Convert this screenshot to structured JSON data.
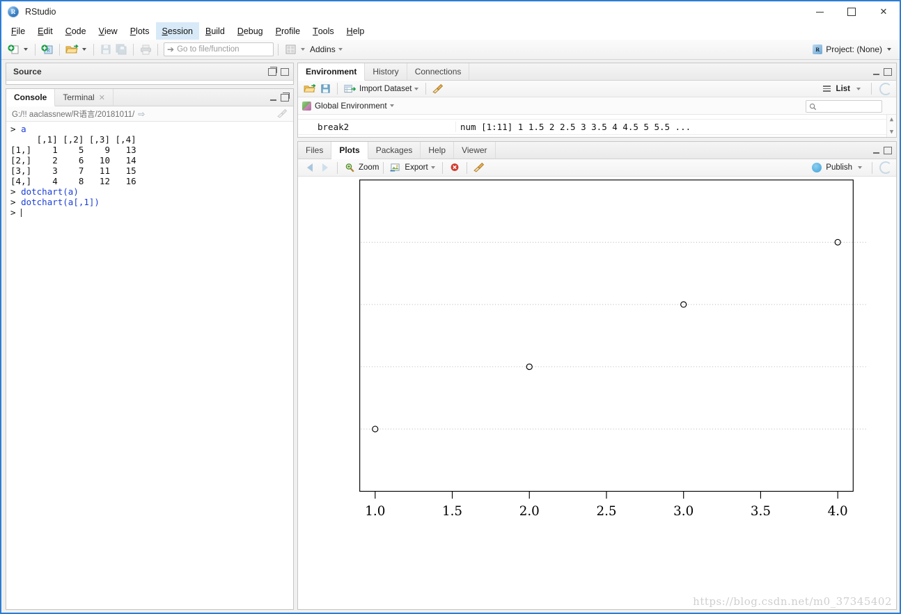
{
  "window": {
    "title": "RStudio",
    "app_icon": "r-logo-icon",
    "minimize": "minimize-icon",
    "maximize": "maximize-icon",
    "close": "close-icon"
  },
  "menubar": {
    "items": [
      {
        "label": "File",
        "accel": "F",
        "active": false
      },
      {
        "label": "Edit",
        "accel": "E",
        "active": false
      },
      {
        "label": "Code",
        "accel": "C",
        "active": false
      },
      {
        "label": "View",
        "accel": "V",
        "active": false
      },
      {
        "label": "Plots",
        "accel": "P",
        "active": false
      },
      {
        "label": "Session",
        "accel": "S",
        "active": true
      },
      {
        "label": "Build",
        "accel": "B",
        "active": false
      },
      {
        "label": "Debug",
        "accel": "D",
        "active": false
      },
      {
        "label": "Profile",
        "accel": "P",
        "active": false
      },
      {
        "label": "Tools",
        "accel": "T",
        "active": false
      },
      {
        "label": "Help",
        "accel": "H",
        "active": false
      }
    ]
  },
  "toolbar": {
    "new_file_icon": "new-file-icon",
    "new_project_icon": "new-project-icon",
    "open_icon": "open-folder-icon",
    "save_icon": "save-icon",
    "save_all_icon": "save-all-icon",
    "print_icon": "print-icon",
    "goto_placeholder": "Go to file/function",
    "goto_value": "",
    "panes_icon": "panes-layout-icon",
    "addins_label": "Addins",
    "project_label": "Project: (None)"
  },
  "source": {
    "title": "Source",
    "minimize_icon": "restore-pane-icon",
    "maximize_icon": "maximize-pane-icon"
  },
  "console": {
    "tabs": [
      {
        "label": "Console",
        "selected": true,
        "closable": false
      },
      {
        "label": "Terminal",
        "selected": false,
        "closable": true
      }
    ],
    "path": "G:/!! aaclassnew/R语言/20181011/",
    "path_arrow_icon": "goto-directory-icon",
    "clear_icon": "broom-clear-icon",
    "lines": [
      {
        "type": "input",
        "prompt": "> ",
        "text": "a"
      },
      {
        "type": "output",
        "prompt": "",
        "text": "     [,1] [,2] [,3] [,4]"
      },
      {
        "type": "output",
        "prompt": "",
        "text": "[1,]    1    5    9   13"
      },
      {
        "type": "output",
        "prompt": "",
        "text": "[2,]    2    6   10   14"
      },
      {
        "type": "output",
        "prompt": "",
        "text": "[3,]    3    7   11   15"
      },
      {
        "type": "output",
        "prompt": "",
        "text": "[4,]    4    8   12   16"
      },
      {
        "type": "input",
        "prompt": "> ",
        "text": "dotchart(a)"
      },
      {
        "type": "input",
        "prompt": "> ",
        "text": "dotchart(a[,1])"
      },
      {
        "type": "cursor",
        "prompt": "> ",
        "text": ""
      }
    ]
  },
  "environment": {
    "tabs": [
      {
        "label": "Environment",
        "selected": true
      },
      {
        "label": "History",
        "selected": false
      },
      {
        "label": "Connections",
        "selected": false
      }
    ],
    "toolbar": {
      "load_icon": "open-workspace-icon",
      "save_icon": "save-workspace-icon",
      "import_icon": "import-dataset-icon",
      "import_label": "Import Dataset",
      "clear_icon": "broom-clear-icon",
      "view_mode_icon": "list-view-icon",
      "view_mode_label": "List",
      "refresh_icon": "refresh-icon"
    },
    "scope": {
      "icon": "global-environment-icon",
      "label": "Global Environment"
    },
    "search_icon": "search-icon",
    "search_value": "",
    "rows": [
      {
        "name": "break2",
        "value": "num [1:11] 1 1.5 2 2.5 3 3.5 4 4.5 5 5.5 ..."
      }
    ],
    "scroll_up_icon": "scroll-up-icon",
    "scroll_down_icon": "scroll-down-icon"
  },
  "plots": {
    "tabs": [
      {
        "label": "Files",
        "selected": false
      },
      {
        "label": "Plots",
        "selected": true
      },
      {
        "label": "Packages",
        "selected": false
      },
      {
        "label": "Help",
        "selected": false
      },
      {
        "label": "Viewer",
        "selected": false
      }
    ],
    "toolbar": {
      "back_icon": "back-arrow-icon",
      "forward_icon": "forward-arrow-icon",
      "zoom_icon": "zoom-icon",
      "zoom_label": "Zoom",
      "export_icon": "export-icon",
      "export_label": "Export",
      "remove_icon": "remove-plot-icon",
      "clear_all_icon": "broom-clear-icon",
      "publish_icon": "publish-icon",
      "publish_label": "Publish",
      "refresh_icon": "refresh-icon"
    },
    "watermark": "https://blog.csdn.net/m0_37345402"
  },
  "chart_data": {
    "type": "scatter",
    "chart_kind": "dotchart",
    "title": "",
    "xlabel": "",
    "ylabel": "",
    "x": [
      4,
      3,
      2,
      1
    ],
    "y": [
      4,
      3,
      2,
      1
    ],
    "values": [
      1,
      2,
      3,
      4
    ],
    "point_marker": "open-circle",
    "gridlines": "horizontal-dotted",
    "grid": true,
    "xlim": [
      0.9,
      4.1
    ],
    "xticks": [
      1.0,
      1.5,
      2.0,
      2.5,
      3.0,
      3.5,
      4.0
    ],
    "xtick_labels": [
      "1.0",
      "1.5",
      "2.0",
      "2.5",
      "3.0",
      "3.5",
      "4.0"
    ],
    "yticks": [],
    "ytick_labels": [],
    "box": true,
    "legend": null
  }
}
